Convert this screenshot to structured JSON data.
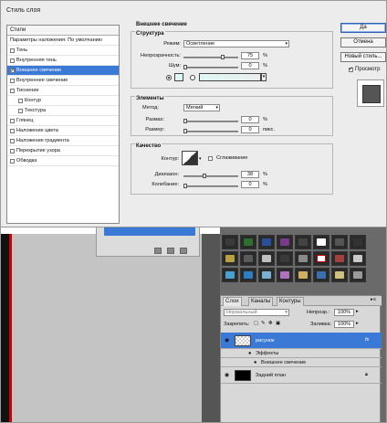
{
  "dialog": {
    "title": "Стиль слоя",
    "styles_header": "Стили",
    "style_items": [
      {
        "label": "Параметры наложения: По умолчанию",
        "checkbox": false,
        "checked": false,
        "selected": false,
        "indent": false
      },
      {
        "label": "Тень",
        "checkbox": true,
        "checked": false,
        "selected": false,
        "indent": false
      },
      {
        "label": "Внутренняя тень",
        "checkbox": true,
        "checked": false,
        "selected": false,
        "indent": false
      },
      {
        "label": "Внешнее свечение",
        "checkbox": true,
        "checked": true,
        "selected": true,
        "indent": false
      },
      {
        "label": "Внутреннее свечение",
        "checkbox": true,
        "checked": false,
        "selected": false,
        "indent": false
      },
      {
        "label": "Тиснение",
        "checkbox": true,
        "checked": false,
        "selected": false,
        "indent": false
      },
      {
        "label": "Контур",
        "checkbox": true,
        "checked": false,
        "selected": false,
        "indent": true
      },
      {
        "label": "Текстура",
        "checkbox": true,
        "checked": false,
        "selected": false,
        "indent": true
      },
      {
        "label": "Глянец",
        "checkbox": true,
        "checked": false,
        "selected": false,
        "indent": false
      },
      {
        "label": "Наложение цвета",
        "checkbox": true,
        "checked": false,
        "selected": false,
        "indent": false
      },
      {
        "label": "Наложение градиента",
        "checkbox": true,
        "checked": false,
        "selected": false,
        "indent": false
      },
      {
        "label": "Перекрытие узора",
        "checkbox": true,
        "checked": false,
        "selected": false,
        "indent": false
      },
      {
        "label": "Обводка",
        "checkbox": true,
        "checked": false,
        "selected": false,
        "indent": false
      }
    ],
    "section_title": "Внешнее свечение",
    "structure": {
      "title": "Структура",
      "mode_label": "Режим:",
      "mode_value": "Осветление",
      "opacity_label": "Непрозрачность:",
      "opacity_value": "75",
      "opacity_fraction": 0.75,
      "noise_label": "Шум:",
      "noise_value": "0",
      "noise_fraction": 0,
      "percent": "%",
      "glow_color": "#dff7f4"
    },
    "elements": {
      "title": "Элементы",
      "method_label": "Метод:",
      "method_value": "Мягкий",
      "spread_label": "Размах:",
      "spread_value": "0",
      "size_label": "Размер:",
      "size_value": "0",
      "size_unit": "пикс.",
      "percent": "%"
    },
    "quality": {
      "title": "Качество",
      "contour_label": "Контур:",
      "antialias_label": "Сглаживание",
      "range_label": "Диапазон:",
      "range_value": "38",
      "range_fraction": 0.38,
      "jitter_label": "Колебание:",
      "jitter_value": "0",
      "percent": "%"
    },
    "buttons": {
      "ok": "Да",
      "cancel": "Отмена",
      "new_style": "Новый стиль...",
      "preview": "Просмотр"
    }
  },
  "layers_panel": {
    "tabs": [
      "Слои",
      "Каналы",
      "Контуры"
    ],
    "blend_mode": "Нормальный",
    "opacity_label": "Непрозр.:",
    "opacity_value": "100%",
    "lock_label": "Закрепить:",
    "fill_label": "Заливка:",
    "fill_value": "100%",
    "layers": [
      {
        "name": "рисунок",
        "selected": true,
        "fx": "fx"
      },
      {
        "name": "Эффекты",
        "sub": true
      },
      {
        "name": "Внешнее свечение",
        "sub2": true
      },
      {
        "name": "Задний план",
        "selected": false,
        "locked": true
      }
    ]
  }
}
